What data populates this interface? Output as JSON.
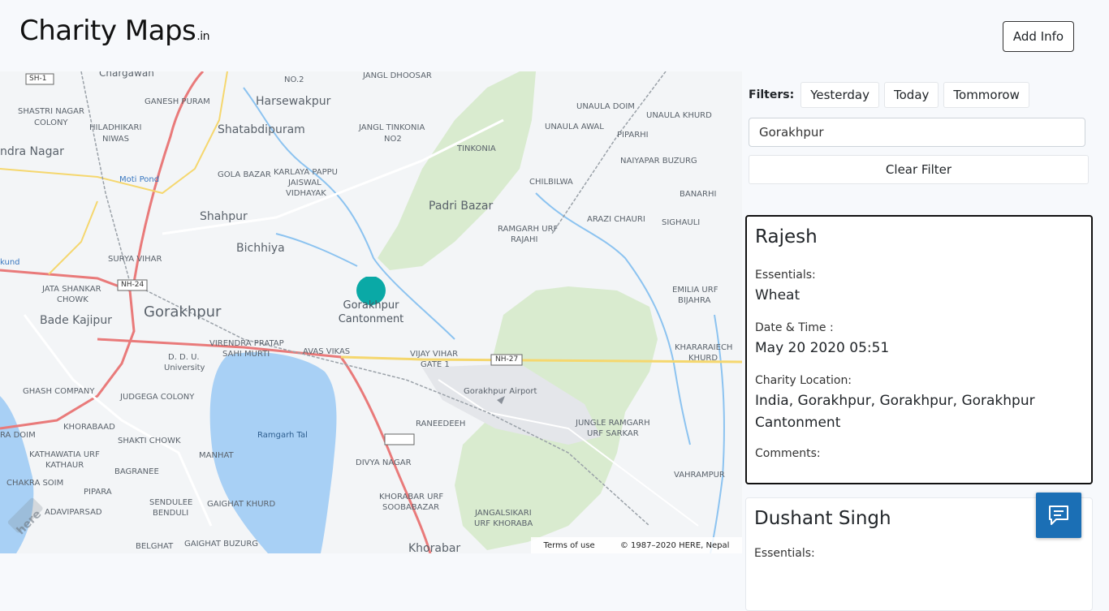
{
  "header": {
    "brand": "Charity Maps",
    "brand_tld": ".in",
    "add_info_label": "Add Info"
  },
  "filters": {
    "label": "Filters:",
    "chips": [
      "Yesterday",
      "Today",
      "Tommorow"
    ],
    "location_value": "Gorakhpur",
    "clear_label": "Clear Filter"
  },
  "cards": [
    {
      "name": "Rajesh",
      "essentials_label": "Essentials:",
      "essentials": "Wheat",
      "datetime_label": "Date & Time :",
      "datetime": "May 20 2020 05:51",
      "location_label": "Charity Location:",
      "location": "India, Gorakhpur, Gorakhpur, Gorakhpur Cantonment",
      "comments_label": "Comments:",
      "comments": ""
    },
    {
      "name": "Dushant Singh",
      "essentials_label": "Essentials:"
    }
  ],
  "map": {
    "attribution_terms": "Terms of use",
    "attribution_copyright": "© 1987–2020 HERE, Nepal",
    "watermark": "here",
    "marker_label": "Gorakhpur Cantonment",
    "places": [
      "SH-1",
      "Chargawan",
      "NO.2",
      "JANGL DHOOSAR",
      "SHASTRI NAGAR",
      "COLONY",
      "GANESH PURAM",
      "Harsewakpur",
      "UNAULA DOIM",
      "UNAULA KHURD",
      "HILADHIKARI",
      "NIWAS",
      "Shatabdipuram",
      "JANGL TINKONIA",
      "NO2",
      "UNAULA AWAL",
      "PIPARHI",
      "ndra Nagar",
      "TINKONIA",
      "Moti Pond",
      "GOLA BAZAR",
      "KARLAYA PAPPU",
      "JAISWAL",
      "VIDHAYAK",
      "NAIYAPAR BUZURG",
      "CHILBILWA",
      "BANARHI",
      "Padri Bazar",
      "Shahpur",
      "ARAZI CHAURI",
      "SIGHAULI",
      "RAMGARH URF",
      "RAJAHI",
      "Bichhiya",
      "kund",
      "SURYA VIHAR",
      "NH-24",
      "EMILIA URF",
      "BIJAHRA",
      "JATA SHANKAR",
      "CHOWK",
      "Gorakhpur",
      "Bade Kajipur",
      "VIRENDRA PRATAP",
      "SAHI MURTI",
      "AVAS VIKAS",
      "VIJAY VIHAR",
      "GATE 1",
      "NH-27",
      "KHARARAIECH",
      "KHURD",
      "D. D. U.",
      "University",
      "GHASH COMPANY",
      "JUDGEGA COLONY",
      "Gorakhpur Airport",
      "KHORABAAD",
      "RANEEDEEH",
      "JUNGLE RAMGARH",
      "URF SARKAR",
      "RA DOIM",
      "SHAKTI CHOWK",
      "Ramgarh Tal",
      "KATHAWATIA URF",
      "KATHAUR",
      "MANHAT",
      "DIVYA NAGAR",
      "BAGRANEE",
      "VAHRAMPUR",
      "CHAKRA SOIM",
      "PIPARA",
      "KHORABAR URF",
      "SOOBABAZAR",
      "ADAVIPARSAD",
      "SENDULEE",
      "BENDULI",
      "GAIGHAT KHURD",
      "JANGALSIKARI",
      "URF KHORABA",
      "BELGHAT",
      "GAIGHAT BUZURG",
      "Khorabar"
    ]
  },
  "chat": {
    "icon": "chat-icon"
  }
}
